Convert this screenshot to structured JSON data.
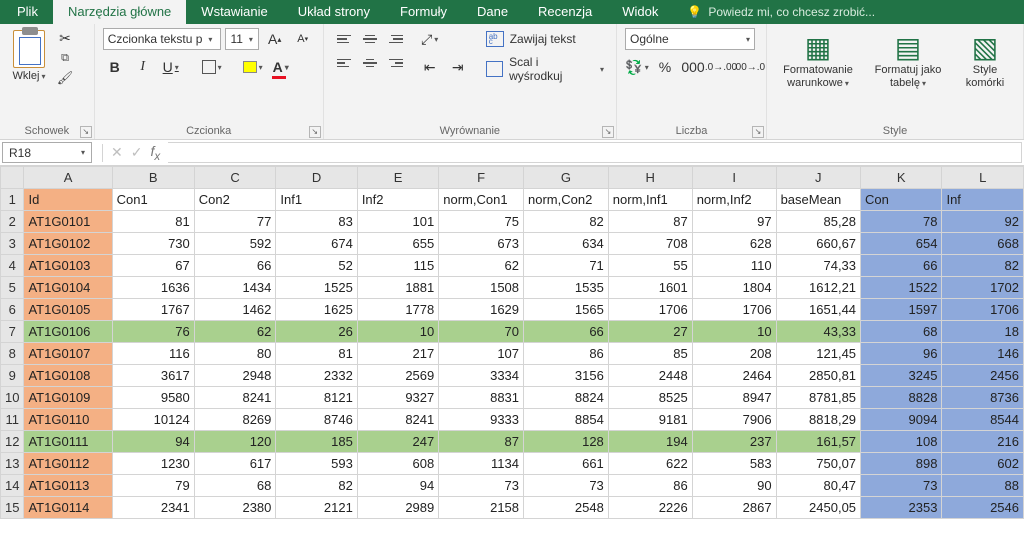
{
  "tabs": {
    "file": "Plik",
    "home": "Narzędzia główne",
    "insert": "Wstawianie",
    "layout": "Układ strony",
    "formulas": "Formuły",
    "data": "Dane",
    "review": "Recenzja",
    "view": "Widok",
    "tellme": "Powiedz mi, co chcesz zrobić..."
  },
  "ribbon": {
    "clipboard": {
      "paste": "Wklej",
      "label": "Schowek"
    },
    "font": {
      "name": "Czcionka tekstu p",
      "size": "11",
      "label": "Czcionka"
    },
    "alignment": {
      "wrap": "Zawijaj tekst",
      "merge": "Scal i wyśrodkuj",
      "label": "Wyrównanie"
    },
    "number": {
      "format": "Ogólne",
      "label": "Liczba"
    },
    "styles": {
      "condfmt": "Formatowanie\nwarunkowe",
      "astable": "Formatuj jako\ntabelę",
      "cellstyles": "Style\nkomórki",
      "label": "Style"
    }
  },
  "namebox": "R18",
  "columns": [
    "A",
    "B",
    "C",
    "D",
    "E",
    "F",
    "G",
    "H",
    "I",
    "J",
    "K",
    "L"
  ],
  "headers": [
    "Id",
    "Con1",
    "Con2",
    "Inf1",
    "Inf2",
    "norm,Con1",
    "norm,Con2",
    "norm,Inf1",
    "norm,Inf2",
    "baseMean",
    "Con",
    "Inf"
  ],
  "rows": [
    {
      "n": 2,
      "id": "AT1G0101",
      "v": [
        81,
        77,
        83,
        101,
        75,
        82,
        87,
        97,
        "85,28",
        78,
        92
      ]
    },
    {
      "n": 3,
      "id": "AT1G0102",
      "v": [
        730,
        592,
        674,
        655,
        673,
        634,
        708,
        628,
        "660,67",
        654,
        668
      ]
    },
    {
      "n": 4,
      "id": "AT1G0103",
      "v": [
        67,
        66,
        52,
        115,
        62,
        71,
        55,
        110,
        "74,33",
        66,
        82
      ]
    },
    {
      "n": 5,
      "id": "AT1G0104",
      "v": [
        1636,
        1434,
        1525,
        1881,
        1508,
        1535,
        1601,
        1804,
        "1612,21",
        1522,
        1702
      ]
    },
    {
      "n": 6,
      "id": "AT1G0105",
      "v": [
        1767,
        1462,
        1625,
        1778,
        1629,
        1565,
        1706,
        1706,
        "1651,44",
        1597,
        1706
      ]
    },
    {
      "n": 7,
      "id": "AT1G0106",
      "hl": true,
      "v": [
        76,
        62,
        26,
        10,
        70,
        66,
        27,
        10,
        "43,33",
        68,
        18
      ]
    },
    {
      "n": 8,
      "id": "AT1G0107",
      "v": [
        116,
        80,
        81,
        217,
        107,
        86,
        85,
        208,
        "121,45",
        96,
        146
      ]
    },
    {
      "n": 9,
      "id": "AT1G0108",
      "v": [
        3617,
        2948,
        2332,
        2569,
        3334,
        3156,
        2448,
        2464,
        "2850,81",
        3245,
        2456
      ]
    },
    {
      "n": 10,
      "id": "AT1G0109",
      "v": [
        9580,
        8241,
        8121,
        9327,
        8831,
        8824,
        8525,
        8947,
        "8781,85",
        8828,
        8736
      ]
    },
    {
      "n": 11,
      "id": "AT1G0110",
      "v": [
        10124,
        8269,
        8746,
        8241,
        9333,
        8854,
        9181,
        7906,
        "8818,29",
        9094,
        8544
      ]
    },
    {
      "n": 12,
      "id": "AT1G0111",
      "hl": true,
      "v": [
        94,
        120,
        185,
        247,
        87,
        128,
        194,
        237,
        "161,57",
        108,
        216
      ]
    },
    {
      "n": 13,
      "id": "AT1G0112",
      "v": [
        1230,
        617,
        593,
        608,
        1134,
        661,
        622,
        583,
        "750,07",
        898,
        602
      ]
    },
    {
      "n": 14,
      "id": "AT1G0113",
      "v": [
        79,
        68,
        82,
        94,
        73,
        73,
        86,
        90,
        "80,47",
        73,
        88
      ]
    },
    {
      "n": 15,
      "id": "AT1G0114",
      "v": [
        2341,
        2380,
        2121,
        2989,
        2158,
        2548,
        2226,
        2867,
        "2450,05",
        2353,
        2546
      ]
    }
  ]
}
